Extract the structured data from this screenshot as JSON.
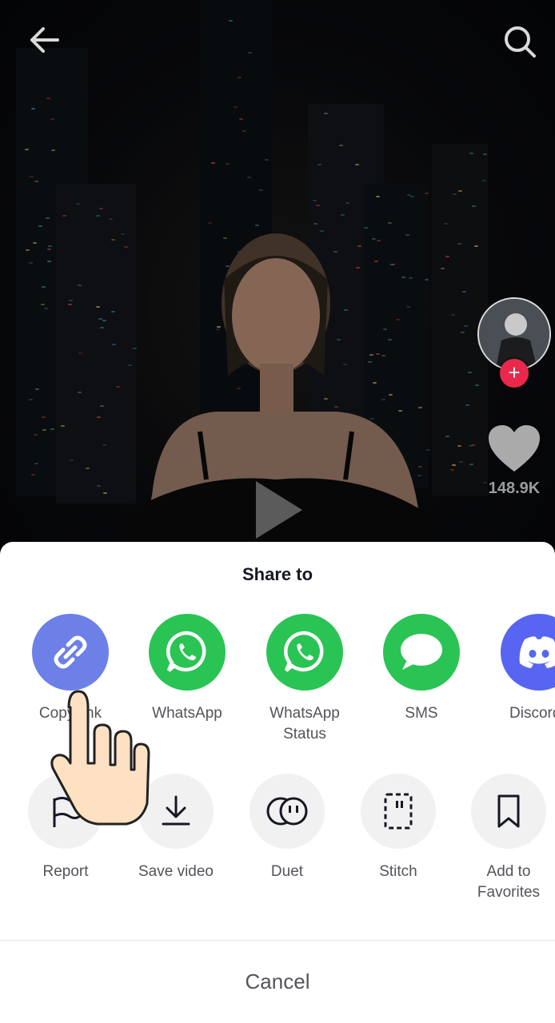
{
  "video": {
    "like_count": "148.9K",
    "icons": {
      "back": "arrow-left-icon",
      "search": "search-icon",
      "play": "play-icon",
      "like": "heart-icon",
      "follow": "plus-icon"
    }
  },
  "share_sheet": {
    "title": "Share to",
    "share_targets": [
      {
        "label": "Copy link",
        "icon": "link-icon",
        "color": "#6c80e8"
      },
      {
        "label": "WhatsApp",
        "icon": "whatsapp-icon",
        "color": "#2ac455"
      },
      {
        "label": "WhatsApp\nStatus",
        "icon": "whatsapp-icon",
        "color": "#2ac455"
      },
      {
        "label": "SMS",
        "icon": "sms-bubble-icon",
        "color": "#2ac455"
      },
      {
        "label": "Discord",
        "icon": "discord-icon",
        "color": "#5865f2"
      }
    ],
    "actions": [
      {
        "label": "Report",
        "icon": "flag-icon"
      },
      {
        "label": "Save video",
        "icon": "download-icon"
      },
      {
        "label": "Duet",
        "icon": "duet-icon"
      },
      {
        "label": "Stitch",
        "icon": "stitch-icon"
      },
      {
        "label": "Add to\nFavorites",
        "icon": "bookmark-icon"
      }
    ],
    "cancel_label": "Cancel"
  }
}
